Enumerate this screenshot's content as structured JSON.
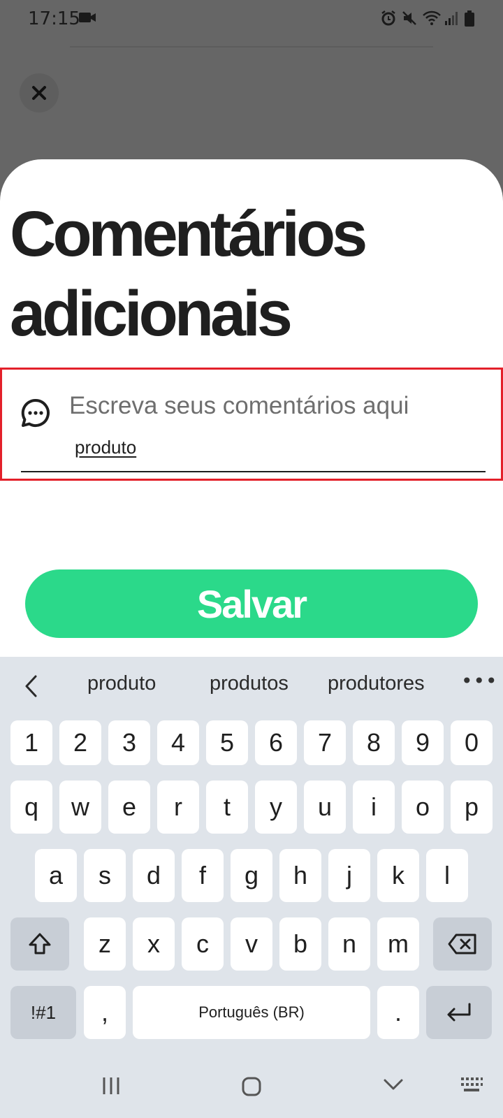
{
  "status_bar": {
    "time": "17:15",
    "icons": [
      "video-camera-icon",
      "alarm-icon",
      "mute-icon",
      "wifi-icon",
      "signal-icon",
      "battery-icon"
    ]
  },
  "close_icon": "close-icon",
  "sheet": {
    "title_line1": "Comentários",
    "title_line2": "adicionais"
  },
  "comment": {
    "icon": "chat-bubble-icon",
    "placeholder": "Escreva seus comentários aqui",
    "value": "produto"
  },
  "save_button": {
    "label": "Salvar",
    "color": "#2bd98a"
  },
  "keyboard": {
    "suggestions": [
      "produto",
      "produtos",
      "produtores"
    ],
    "row_numbers": [
      "1",
      "2",
      "3",
      "4",
      "5",
      "6",
      "7",
      "8",
      "9",
      "0"
    ],
    "row_1": [
      "q",
      "w",
      "e",
      "r",
      "t",
      "y",
      "u",
      "i",
      "o",
      "p"
    ],
    "row_2": [
      "a",
      "s",
      "d",
      "f",
      "g",
      "h",
      "j",
      "k",
      "l"
    ],
    "row_3": [
      "z",
      "x",
      "c",
      "v",
      "b",
      "n",
      "m"
    ],
    "symbols_label": "!#1",
    "comma": ",",
    "space_label": "Português (BR)",
    "period": ".",
    "accent_color": "#c8ced6"
  },
  "nav_bar": {
    "icons": [
      "recent-apps-icon",
      "home-icon",
      "back-icon",
      "keyboard-icon"
    ]
  }
}
